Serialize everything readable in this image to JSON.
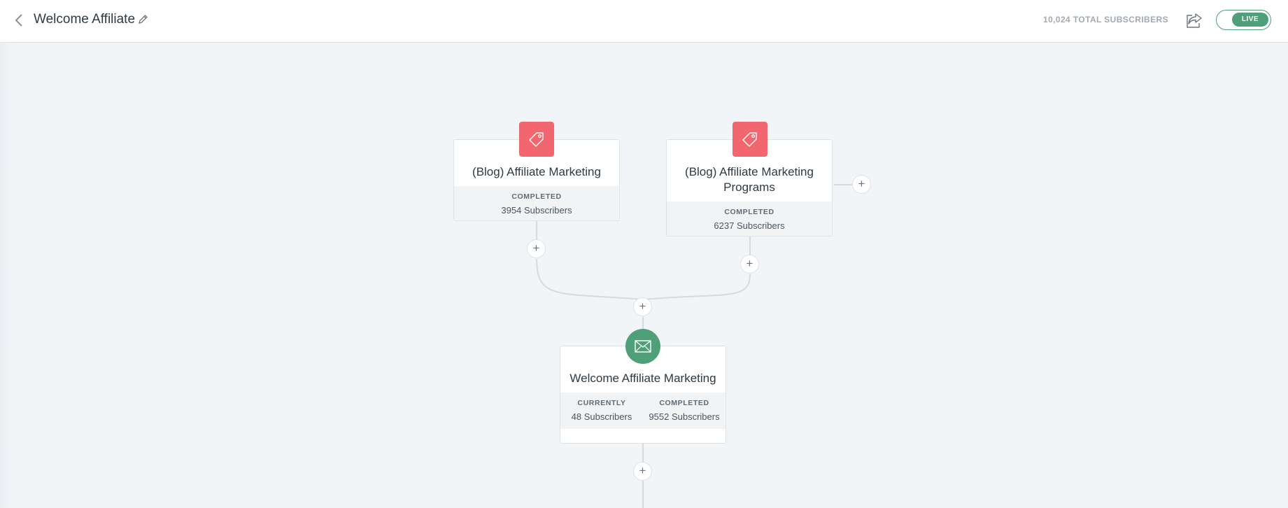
{
  "header": {
    "title": "Welcome Affiliate",
    "total_subscribers": "10,024 TOTAL SUBSCRIBERS",
    "status": "LIVE"
  },
  "nodes": {
    "tag1": {
      "title": "(Blog) Affiliate Marketing",
      "stat_label": "COMPLETED",
      "stat_value": "3954 Subscribers"
    },
    "tag2": {
      "title": "(Blog) Affiliate Marketing Programs",
      "stat_label": "COMPLETED",
      "stat_value": "6237 Subscribers"
    },
    "email": {
      "title": "Welcome Affiliate Marketing",
      "currently_label": "CURRENTLY",
      "currently_value": "48 Subscribers",
      "completed_label": "COMPLETED",
      "completed_value": "9552 Subscribers"
    }
  },
  "add_step_label": "+",
  "icons": {
    "back": "chevron-left-icon",
    "edit": "pencil-icon",
    "share": "share-icon",
    "tag": "tag-icon",
    "email": "envelope-icon"
  },
  "colors": {
    "accent_green": "#4f9f79",
    "tag_red": "#f2666f",
    "background": "#f2f5f8"
  }
}
